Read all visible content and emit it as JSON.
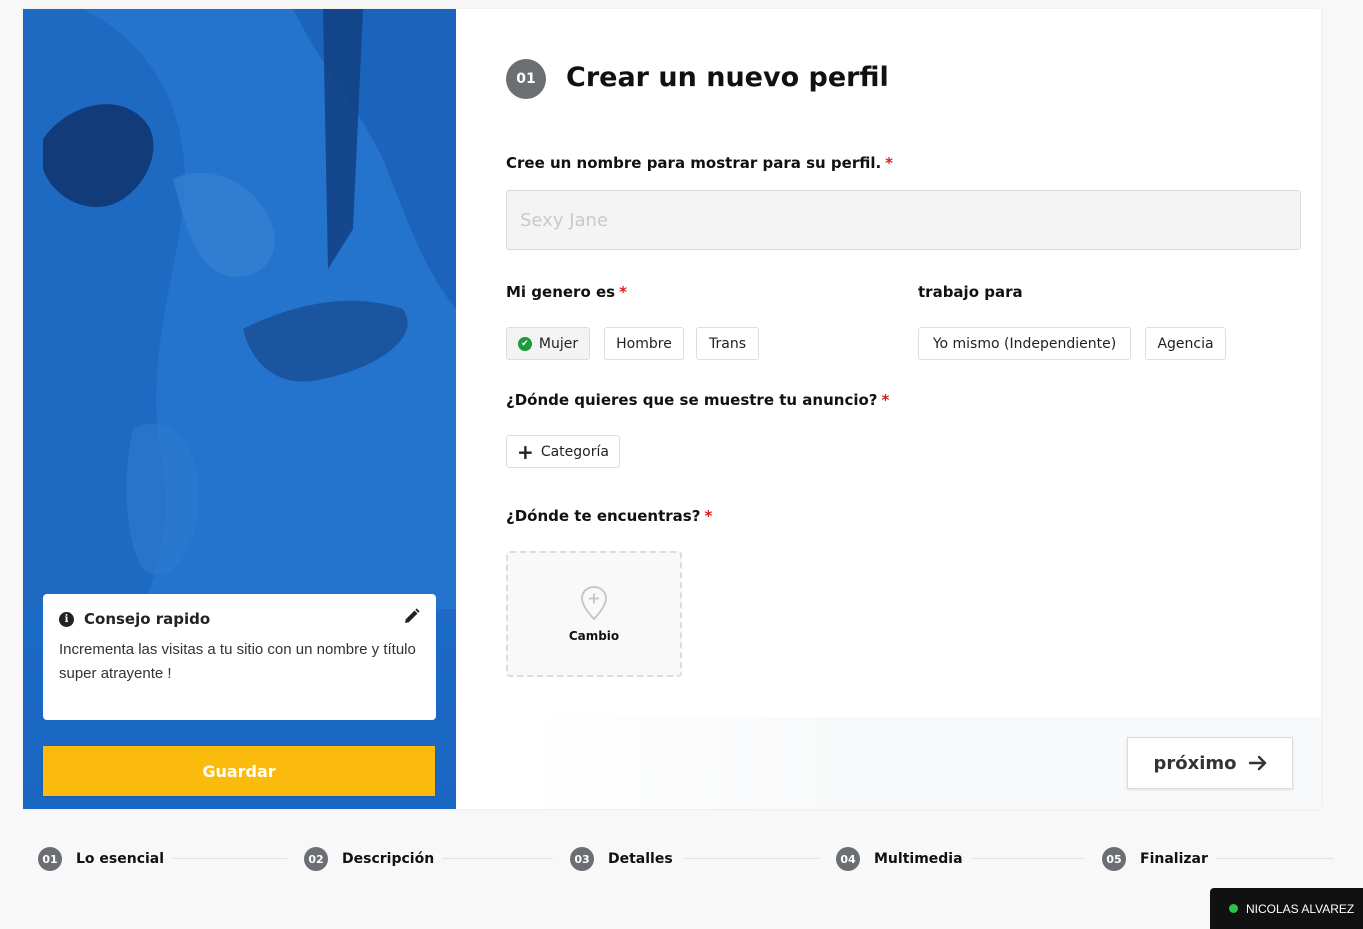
{
  "left_panel": {
    "tip": {
      "title": "Consejo rapido",
      "text": "Incrementa las visitas a tu sitio con un nombre y título super atrayente !",
      "info_icon": "info-icon",
      "edit_icon": "pencil-icon"
    },
    "save_label": "Guardar"
  },
  "form": {
    "step_number": "01",
    "title": "Crear un nuevo perfil",
    "name": {
      "label": "Cree un nombre para mostrar para su perfil.",
      "required": "*",
      "placeholder": "Sexy Jane",
      "value": ""
    },
    "gender": {
      "label": "Mi genero es",
      "required": "*",
      "options": [
        "Mujer",
        "Hombre",
        "Trans"
      ],
      "selected": "Mujer"
    },
    "work": {
      "label": "trabajo para",
      "options": [
        "Yo mismo (Independiente)",
        "Agencia"
      ]
    },
    "placement": {
      "label": "¿Dónde quieres que se muestre tu anuncio?",
      "required": "*",
      "button_label": "Categoría"
    },
    "location": {
      "label": "¿Dónde te encuentras?",
      "required": "*",
      "button_label": "Cambio",
      "icon": "map-pin-plus-icon"
    },
    "next_label": "próximo",
    "next_icon": "arrow-right-icon"
  },
  "steps": [
    {
      "number": "01",
      "label": "Lo esencial"
    },
    {
      "number": "02",
      "label": "Descripción"
    },
    {
      "number": "03",
      "label": "Detalles"
    },
    {
      "number": "04",
      "label": "Multimedia"
    },
    {
      "number": "05",
      "label": "Finalizar"
    }
  ],
  "user": {
    "name": "NICOLAS ALVAREZ",
    "status_color": "#2ec24a"
  },
  "colors": {
    "panel_blue": "#1f6ec8",
    "save_yellow": "#fbbb0d",
    "required_red": "#d81e1e",
    "step_gray": "#6b6e73"
  }
}
